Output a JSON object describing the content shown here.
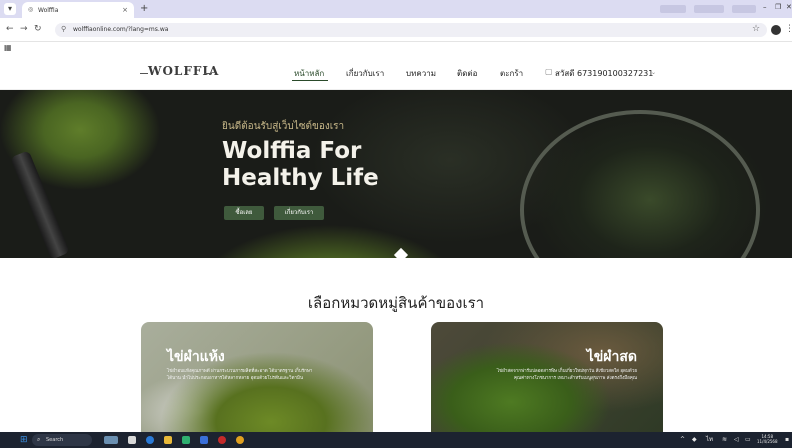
{
  "browser": {
    "tab_title": "Wolffia",
    "tab_icon": "globe-icon",
    "url": "wolffiaonline.com/?lang=ms.wa",
    "new_tab_symbol": "+",
    "close_symbol": "×"
  },
  "site": {
    "logo": "WOLFFIA",
    "nav": [
      "หน้าหลัก",
      "เกี่ยวกับเรา",
      "บทความ",
      "ติดต่อ",
      "ตะกร้า"
    ],
    "greeting": "สวัสดี 673190100327231"
  },
  "hero": {
    "subtitle": "ยินดีต้อนรับสู่เว็บไซต์ของเรา",
    "title_line1": "Wolffia For",
    "title_line2": "Healthy Life",
    "button_shop": "ซื้อเลย",
    "button_about": "เกี่ยวกับเรา"
  },
  "categories": {
    "heading": "เลือกหมวดหมู่สินค้าของเรา",
    "items": [
      {
        "title": "ไข่ผำแห้ง",
        "description": "ไข่ผำอบแห้งคุณภาพดี ผ่านกระบวนการผลิตที่สะอาด ได้มาตรฐาน เก็บรักษาได้นาน นำไปประกอบอาหารได้หลากหลาย อุดมด้วยโปรตีนและวิตามิน"
      },
      {
        "title": "ไข่ผำสด",
        "description": "ไข่ผำสดจากฟาร์มปลอดสารพิษ เก็บเกี่ยวใหม่ทุกวัน สีเขียวสดใส อุดมด้วยคุณค่าทางโภชนาการ เหมาะสำหรับเมนูสุขภาพ ส่งตรงถึงมือคุณ"
      }
    ]
  },
  "taskbar": {
    "search_placeholder": "Search",
    "time": "14:58",
    "date": "11/4/2568"
  },
  "colors": {
    "accent_green": "#3f5a3c",
    "hero_gold": "#c9b98a",
    "tab_strip": "#dcdcf2"
  }
}
